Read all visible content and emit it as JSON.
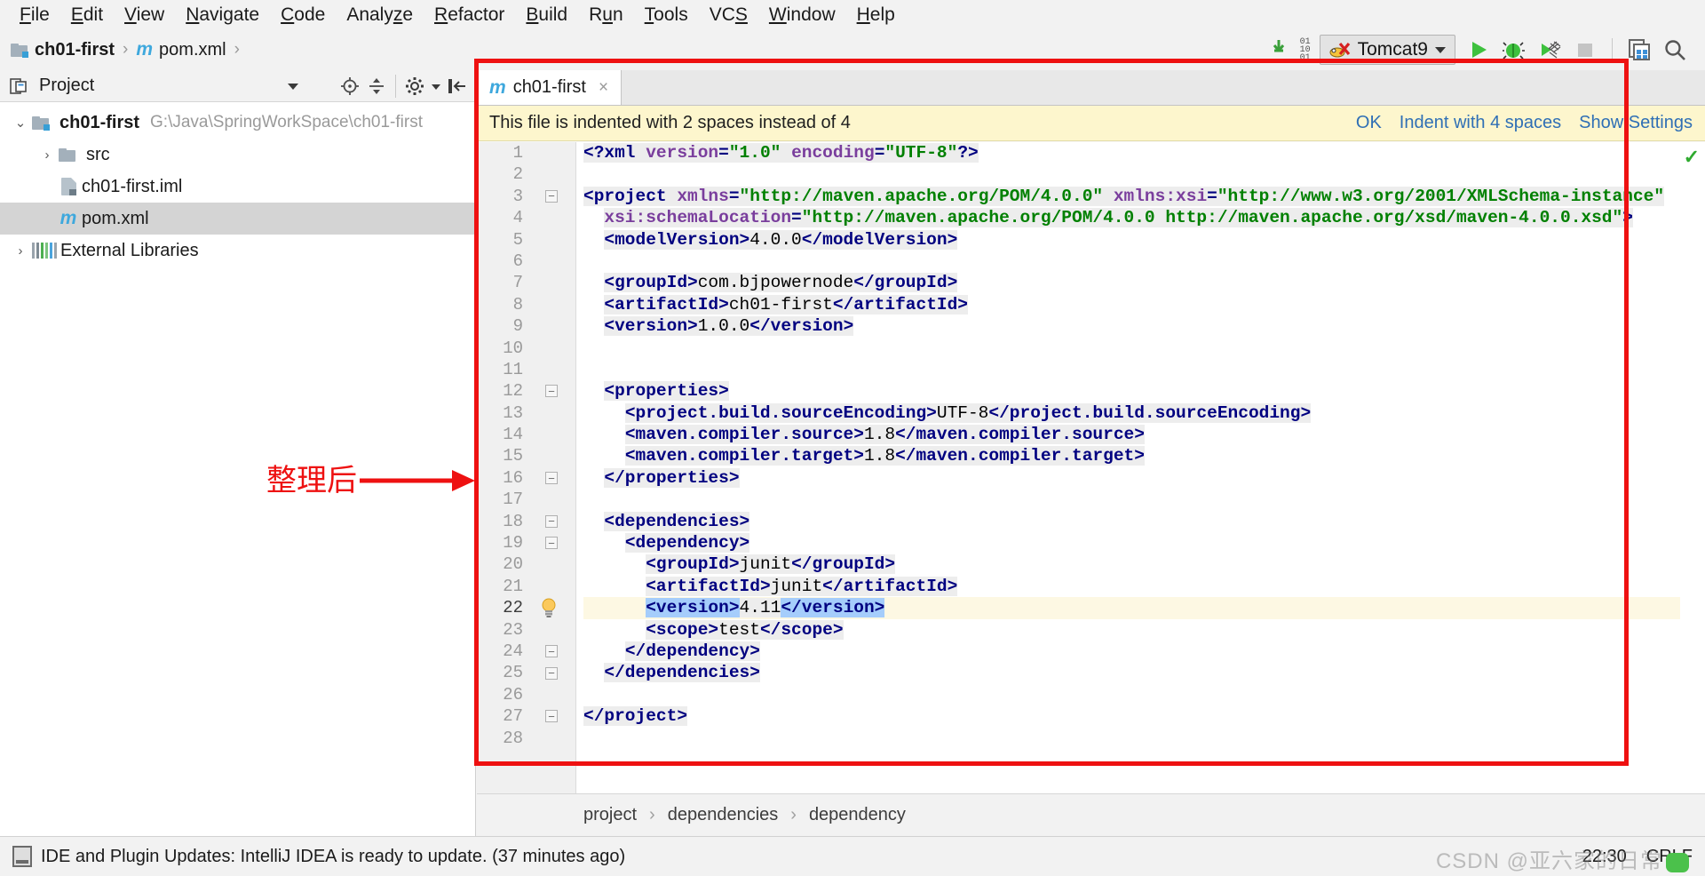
{
  "app": {
    "title": "IntelliJ IDEA"
  },
  "menubar": {
    "items": [
      {
        "label": "File",
        "mnemonic": "F"
      },
      {
        "label": "Edit",
        "mnemonic": "E"
      },
      {
        "label": "View",
        "mnemonic": "V"
      },
      {
        "label": "Navigate",
        "mnemonic": "N"
      },
      {
        "label": "Code",
        "mnemonic": "C"
      },
      {
        "label": "Analyze",
        "mnemonic": "z"
      },
      {
        "label": "Refactor",
        "mnemonic": "R"
      },
      {
        "label": "Build",
        "mnemonic": "B"
      },
      {
        "label": "Run",
        "mnemonic": "u"
      },
      {
        "label": "Tools",
        "mnemonic": "T"
      },
      {
        "label": "VCS",
        "mnemonic": "S"
      },
      {
        "label": "Window",
        "mnemonic": "W"
      },
      {
        "label": "Help",
        "mnemonic": "H"
      }
    ]
  },
  "navbar": {
    "crumbs": [
      {
        "label": "ch01-first",
        "icon": "module-folder-icon"
      },
      {
        "label": "pom.xml",
        "icon": "maven-icon"
      }
    ],
    "separator": "›"
  },
  "toolbar": {
    "download_icon": "download-updates-icon",
    "download_digits": [
      "01",
      "10",
      "01"
    ],
    "run_config": {
      "label": "Tomcat9",
      "icon": "tomcat-icon"
    },
    "buttons": [
      {
        "name": "run-button",
        "label": "Run"
      },
      {
        "name": "debug-button",
        "label": "Debug"
      },
      {
        "name": "run-coverage-button",
        "label": "Run with Coverage"
      },
      {
        "name": "stop-button",
        "label": "Stop"
      },
      {
        "name": "update-app-button",
        "label": "Update application"
      },
      {
        "name": "search-everywhere-button",
        "label": "Search Everywhere"
      }
    ]
  },
  "project_panel": {
    "title": "Project",
    "header_icons": [
      "project-view-icon",
      "collapse-dropdown-icon",
      "locate-icon",
      "expand-collapse-icon",
      "settings-gear-icon",
      "hide-icon"
    ],
    "tree": [
      {
        "label": "ch01-first",
        "path": "G:\\Java\\SpringWorkSpace\\ch01-first",
        "icon": "module-folder-icon",
        "indent": 0,
        "arrow": "⌄",
        "expanded": true,
        "bold": true,
        "selected": false
      },
      {
        "label": "src",
        "path": "",
        "icon": "folder-icon",
        "indent": 1,
        "arrow": "›",
        "expanded": false,
        "bold": false,
        "selected": false
      },
      {
        "label": "ch01-first.iml",
        "path": "",
        "icon": "iml-file-icon",
        "indent": 1,
        "arrow": "",
        "expanded": false,
        "bold": false,
        "selected": false
      },
      {
        "label": "pom.xml",
        "path": "",
        "icon": "maven-icon",
        "indent": 1,
        "arrow": "",
        "expanded": false,
        "bold": false,
        "selected": true
      },
      {
        "label": "External Libraries",
        "path": "",
        "icon": "libraries-icon",
        "indent": 0,
        "arrow": "›",
        "expanded": false,
        "bold": false,
        "selected": false
      }
    ]
  },
  "editor": {
    "tabs": [
      {
        "label": "ch01-first",
        "icon": "maven-icon",
        "close": "×",
        "active": true
      }
    ],
    "notification": {
      "message": "This file is indented with 2 spaces instead of 4",
      "actions": [
        "OK",
        "Indent with 4 spaces",
        "Show Settings"
      ]
    },
    "inspection_status": "✓",
    "bulb_line": 22,
    "highlight_line": 22,
    "lines": [
      {
        "n": 1,
        "fold": "",
        "tokens": [
          {
            "t": "pi",
            "v": "<?xml "
          },
          {
            "t": "attr",
            "v": "version"
          },
          {
            "t": "tag",
            "v": "="
          },
          {
            "t": "val",
            "v": "\"1.0\""
          },
          {
            "t": "tag",
            "v": " "
          },
          {
            "t": "attr",
            "v": "encoding"
          },
          {
            "t": "tag",
            "v": "="
          },
          {
            "t": "val",
            "v": "\"UTF-8\""
          },
          {
            "t": "pi",
            "v": "?>"
          }
        ],
        "indent": 0
      },
      {
        "n": 2,
        "fold": "",
        "tokens": [],
        "indent": 0
      },
      {
        "n": 3,
        "fold": "minus",
        "tokens": [
          {
            "t": "tag",
            "v": "<project "
          },
          {
            "t": "attr",
            "v": "xmlns"
          },
          {
            "t": "tag",
            "v": "="
          },
          {
            "t": "val",
            "v": "\"http://maven.apache.org/POM/4.0.0\""
          },
          {
            "t": "tag",
            "v": " "
          },
          {
            "t": "attr",
            "v": "xmlns:xsi"
          },
          {
            "t": "tag",
            "v": "="
          },
          {
            "t": "val",
            "v": "\"http://www.w3.org/2001/XMLSchema-instance\""
          }
        ],
        "indent": 0
      },
      {
        "n": 4,
        "fold": "",
        "tokens": [
          {
            "t": "attr",
            "v": "xsi:schemaLocation"
          },
          {
            "t": "tag",
            "v": "="
          },
          {
            "t": "val",
            "v": "\"http://maven.apache.org/POM/4.0.0 http://maven.apache.org/xsd/maven-4.0.0.xsd\""
          },
          {
            "t": "tag",
            "v": ">"
          }
        ],
        "indent": 1
      },
      {
        "n": 5,
        "fold": "",
        "tokens": [
          {
            "t": "tag",
            "v": "<modelVersion>"
          },
          {
            "t": "txt",
            "v": "4.0.0"
          },
          {
            "t": "tag",
            "v": "</modelVersion>"
          }
        ],
        "indent": 1
      },
      {
        "n": 6,
        "fold": "",
        "tokens": [],
        "indent": 0
      },
      {
        "n": 7,
        "fold": "",
        "tokens": [
          {
            "t": "tag",
            "v": "<groupId>"
          },
          {
            "t": "txt",
            "v": "com.bjpowernode"
          },
          {
            "t": "tag",
            "v": "</groupId>"
          }
        ],
        "indent": 1
      },
      {
        "n": 8,
        "fold": "",
        "tokens": [
          {
            "t": "tag",
            "v": "<artifactId>"
          },
          {
            "t": "txt",
            "v": "ch01-first"
          },
          {
            "t": "tag",
            "v": "</artifactId>"
          }
        ],
        "indent": 1
      },
      {
        "n": 9,
        "fold": "",
        "tokens": [
          {
            "t": "tag",
            "v": "<version>"
          },
          {
            "t": "txt",
            "v": "1.0.0"
          },
          {
            "t": "tag",
            "v": "</version>"
          }
        ],
        "indent": 1
      },
      {
        "n": 10,
        "fold": "",
        "tokens": [],
        "indent": 0
      },
      {
        "n": 11,
        "fold": "",
        "tokens": [],
        "indent": 0
      },
      {
        "n": 12,
        "fold": "minus",
        "tokens": [
          {
            "t": "tag",
            "v": "<properties>"
          }
        ],
        "indent": 1
      },
      {
        "n": 13,
        "fold": "",
        "tokens": [
          {
            "t": "tag",
            "v": "<project.build.sourceEncoding>"
          },
          {
            "t": "txt",
            "v": "UTF-8"
          },
          {
            "t": "tag",
            "v": "</project.build.sourceEncoding>"
          }
        ],
        "indent": 2
      },
      {
        "n": 14,
        "fold": "",
        "tokens": [
          {
            "t": "tag",
            "v": "<maven.compiler.source>"
          },
          {
            "t": "txt",
            "v": "1.8"
          },
          {
            "t": "tag",
            "v": "</maven.compiler.source>"
          }
        ],
        "indent": 2
      },
      {
        "n": 15,
        "fold": "",
        "tokens": [
          {
            "t": "tag",
            "v": "<maven.compiler.target>"
          },
          {
            "t": "txt",
            "v": "1.8"
          },
          {
            "t": "tag",
            "v": "</maven.compiler.target>"
          }
        ],
        "indent": 2
      },
      {
        "n": 16,
        "fold": "minus",
        "tokens": [
          {
            "t": "tag",
            "v": "</properties>"
          }
        ],
        "indent": 1
      },
      {
        "n": 17,
        "fold": "",
        "tokens": [],
        "indent": 0
      },
      {
        "n": 18,
        "fold": "minus",
        "tokens": [
          {
            "t": "tag",
            "v": "<dependencies>"
          }
        ],
        "indent": 1
      },
      {
        "n": 19,
        "fold": "minus",
        "tokens": [
          {
            "t": "tag",
            "v": "<dependency>"
          }
        ],
        "indent": 2
      },
      {
        "n": 20,
        "fold": "",
        "tokens": [
          {
            "t": "tag",
            "v": "<groupId>"
          },
          {
            "t": "txt",
            "v": "junit"
          },
          {
            "t": "tag",
            "v": "</groupId>"
          }
        ],
        "indent": 3
      },
      {
        "n": 21,
        "fold": "",
        "tokens": [
          {
            "t": "tag",
            "v": "<artifactId>"
          },
          {
            "t": "txt",
            "v": "junit"
          },
          {
            "t": "tag",
            "v": "</artifactId>"
          }
        ],
        "indent": 3
      },
      {
        "n": 22,
        "fold": "",
        "tokens": [
          {
            "t": "tag-sel",
            "v": "<version>"
          },
          {
            "t": "txt",
            "v": "4.11"
          },
          {
            "t": "tag-sel",
            "v": "</version>"
          }
        ],
        "indent": 3
      },
      {
        "n": 23,
        "fold": "",
        "tokens": [
          {
            "t": "tag",
            "v": "<scope>"
          },
          {
            "t": "txt",
            "v": "test"
          },
          {
            "t": "tag",
            "v": "</scope>"
          }
        ],
        "indent": 3
      },
      {
        "n": 24,
        "fold": "minus",
        "tokens": [
          {
            "t": "tag",
            "v": "</dependency>"
          }
        ],
        "indent": 2
      },
      {
        "n": 25,
        "fold": "minus",
        "tokens": [
          {
            "t": "tag",
            "v": "</dependencies>"
          }
        ],
        "indent": 1
      },
      {
        "n": 26,
        "fold": "",
        "tokens": [],
        "indent": 0
      },
      {
        "n": 27,
        "fold": "minus",
        "tokens": [
          {
            "t": "tag",
            "v": "</project>"
          }
        ],
        "indent": 0
      },
      {
        "n": 28,
        "fold": "",
        "tokens": [],
        "indent": 0
      }
    ],
    "breadcrumb": [
      "project",
      "dependencies",
      "dependency"
    ],
    "breadcrumb_separator": "›"
  },
  "statusbar": {
    "icon": "event-log-icon",
    "message": "IDE and Plugin Updates: IntelliJ IDEA is ready to update. (37 minutes ago)",
    "time": "22:30",
    "line_separator": "CRLF",
    "watermark": "CSDN @亚六家的日常"
  },
  "annotation": {
    "text": "整理后",
    "color": "#ee1111"
  },
  "colors": {
    "accent": "#3ea8dd",
    "notification_bg": "#fdf6cd",
    "annotation_red": "#ee1111",
    "tag_blue": "#000080",
    "attr_purple": "#7a3e9d",
    "value_green": "#008000",
    "selection_blue": "#a5cdfb",
    "highlight_row": "#fdf8e3"
  }
}
